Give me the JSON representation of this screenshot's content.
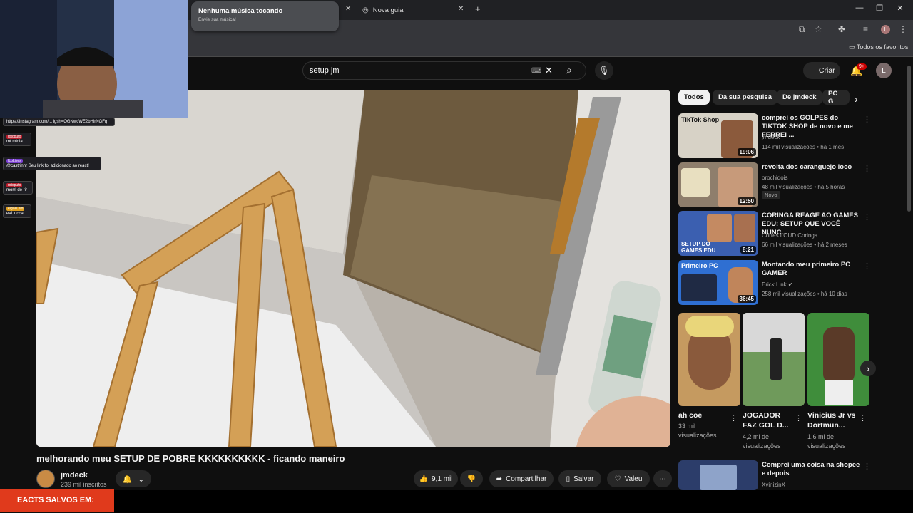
{
  "browser": {
    "tabs": [
      {
        "label": "Nova guia"
      }
    ],
    "bookmarks_label": "Todos os favoritos",
    "profile_initial": "L"
  },
  "notification": {
    "title": "Nenhuma música tocando",
    "subtitle": "Envie sua música!"
  },
  "search": {
    "query": "setup jm"
  },
  "header": {
    "create_label": "Criar",
    "notif_count": "9+",
    "avatar_initial": "L"
  },
  "overlay": {
    "chat": [
      {
        "user": "",
        "text": "https://instagram.com/...\nigsh=OGNwcWE2bHlrNGFq"
      },
      {
        "user": "rotoputo",
        "text": "mt midia"
      },
      {
        "user": "ILoLives",
        "text": "@castrinnr Seu link foi adicionado ao react!"
      },
      {
        "user": "rotoputo",
        "text": "morri de rir"
      },
      {
        "user": "eiguel elo",
        "text": "eai lucca"
      }
    ],
    "bottom_banner": "EACTS SALVOS EM:"
  },
  "video": {
    "title": "melhorando meu SETUP DE POBRE KKKKKKKKKK - ficando maneiro",
    "channel": "jmdeck",
    "subscribers": "239 mil inscritos",
    "likes": "9,1 mil",
    "share_label": "Compartilhar",
    "save_label": "Salvar",
    "thanks_label": "Valeu"
  },
  "chips": [
    "Todos",
    "Da sua pesquisa",
    "De jmdeck",
    "PC G"
  ],
  "recommendations": [
    {
      "title": "comprei os GOLPES do TIKTOK SHOP de novo e me FERREI ...",
      "channel": "jmdeck",
      "meta": "114 mil visualizações • há 1 mês",
      "duration": "19:06",
      "thumb_text": "TikTok Shop",
      "thumb_color": "#d7d2c6"
    },
    {
      "title": "revolta dos caranguejo loco",
      "channel": "orochidois",
      "meta": "48 mil visualizações • há 5 horas",
      "duration": "12:50",
      "badge": "Novo",
      "thumb_color": "#8e7e6c"
    },
    {
      "title": "CORINGA REAGE AO GAMES EDU: SETUP QUE VOCÊ NUNC...",
      "channel": "Cortes LOUD Coringa",
      "meta": "66 mil visualizações • há 2 meses",
      "duration": "8:21",
      "thumb_text": "SETUP DO GAMES EDU",
      "thumb_color": "#3b5fb0"
    },
    {
      "title": "Montando meu primeiro PC GAMER",
      "channel": "Erick Link",
      "meta": "258 mil visualizações • há 10 dias",
      "duration": "36:45",
      "thumb_text": "Primeiro PC",
      "thumb_color": "#2f6fd2"
    }
  ],
  "shorts": [
    {
      "title": "ah coe",
      "views": "33 mil visualizações",
      "color": "#c59a60"
    },
    {
      "title": "JOGADOR FAZ GOL D...",
      "views": "4,2 mi de visualizações",
      "color": "#6f9a5b"
    },
    {
      "title": "Vinicius Jr vs Dortmun...",
      "views": "1,6 mi de visualizações",
      "color": "#3f8d3b"
    }
  ],
  "bottom_rec": {
    "title": "Comprei uma coisa na shopee e depois",
    "channel": "XvinizinX",
    "thumb_color": "#2c3d6a"
  }
}
